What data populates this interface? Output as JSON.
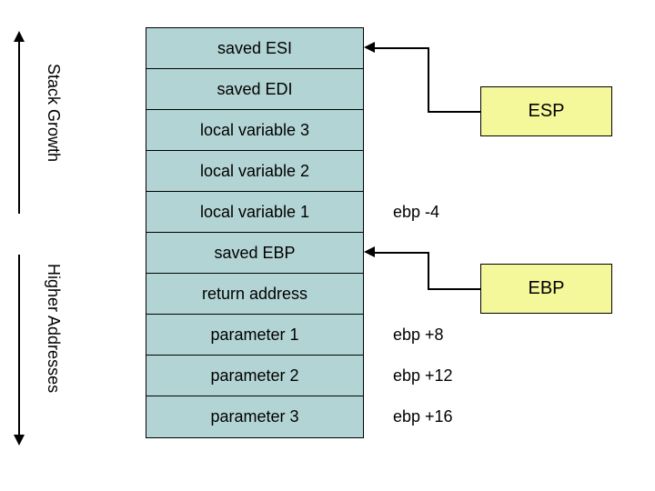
{
  "stack": {
    "cells": [
      "saved ESI",
      "saved EDI",
      "local variable 3",
      "local variable 2",
      "local variable 1",
      "saved EBP",
      "return address",
      "parameter 1",
      "parameter 2",
      "parameter 3"
    ]
  },
  "offsets": {
    "local1": "ebp -4",
    "param1": "ebp +8",
    "param2": "ebp +12",
    "param3": "ebp +16"
  },
  "pointers": {
    "esp": "ESP",
    "ebp": "EBP"
  },
  "labels": {
    "growth": "Stack Growth",
    "higher": "Higher Addresses"
  }
}
